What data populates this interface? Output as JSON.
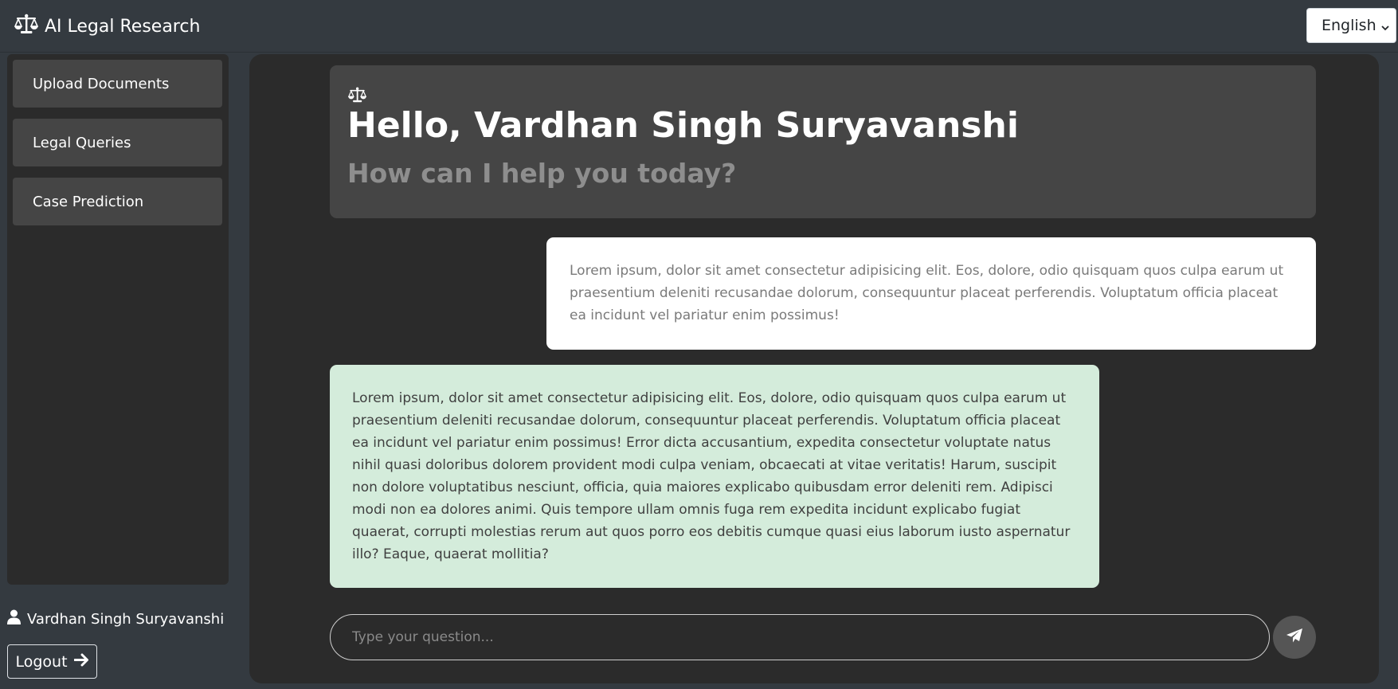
{
  "header": {
    "brand_icon": "scale-balance-icon",
    "title": "AI Legal Research",
    "language": {
      "selected": "English",
      "icon": "chevron-down-icon"
    }
  },
  "sidebar": {
    "items": [
      {
        "label": "Upload Documents"
      },
      {
        "label": "Legal Queries"
      },
      {
        "label": "Case Prediction"
      }
    ],
    "user": {
      "icon": "user-icon",
      "name": "Vardhan Singh Suryavanshi"
    },
    "logout": {
      "label": "Logout",
      "icon": "arrow-right-icon"
    }
  },
  "greeting": {
    "icon": "scale-balance-icon",
    "title": "Hello, Vardhan Singh Suryavanshi",
    "subtitle": "How can I help you today?"
  },
  "messages": [
    {
      "role": "user",
      "text": "Lorem ipsum, dolor sit amet consectetur adipisicing elit. Eos, dolore, odio quisquam quos culpa earum ut praesentium deleniti recusandae dolorum, consequuntur placeat perferendis. Voluptatum officia placeat ea incidunt vel pariatur enim possimus!"
    },
    {
      "role": "assistant",
      "text": "Lorem ipsum, dolor sit amet consectetur adipisicing elit. Eos, dolore, odio quisquam quos culpa earum ut praesentium deleniti recusandae dolorum, consequuntur placeat perferendis. Voluptatum officia placeat ea incidunt vel pariatur enim possimus! Error dicta accusantium, expedita consectetur voluptate natus nihil quasi doloribus dolorem provident modi culpa veniam, obcaecati at vitae veritatis! Harum, suscipit non dolore voluptatibus nesciunt, officia, quia maiores explicabo quibusdam error deleniti rem. Adipisci modi non ea dolores animi. Quis tempore ullam omnis fuga rem expedita incidunt explicabo fugiat quaerat, corrupti molestias rerum aut quos porro eos debitis cumque quasi eius laborum iusto aspernatur illo? Eaque, quaerat mollitia?"
    }
  ],
  "composer": {
    "placeholder": "Type your question...",
    "value": "",
    "send_icon": "paper-plane-icon"
  },
  "colors": {
    "page_bg": "#343a40",
    "panel_bg": "#2b2b2b",
    "nav_button_bg": "#454545",
    "user_bubble_bg": "#ffffff",
    "assistant_bubble_bg": "#d4ecdb"
  }
}
